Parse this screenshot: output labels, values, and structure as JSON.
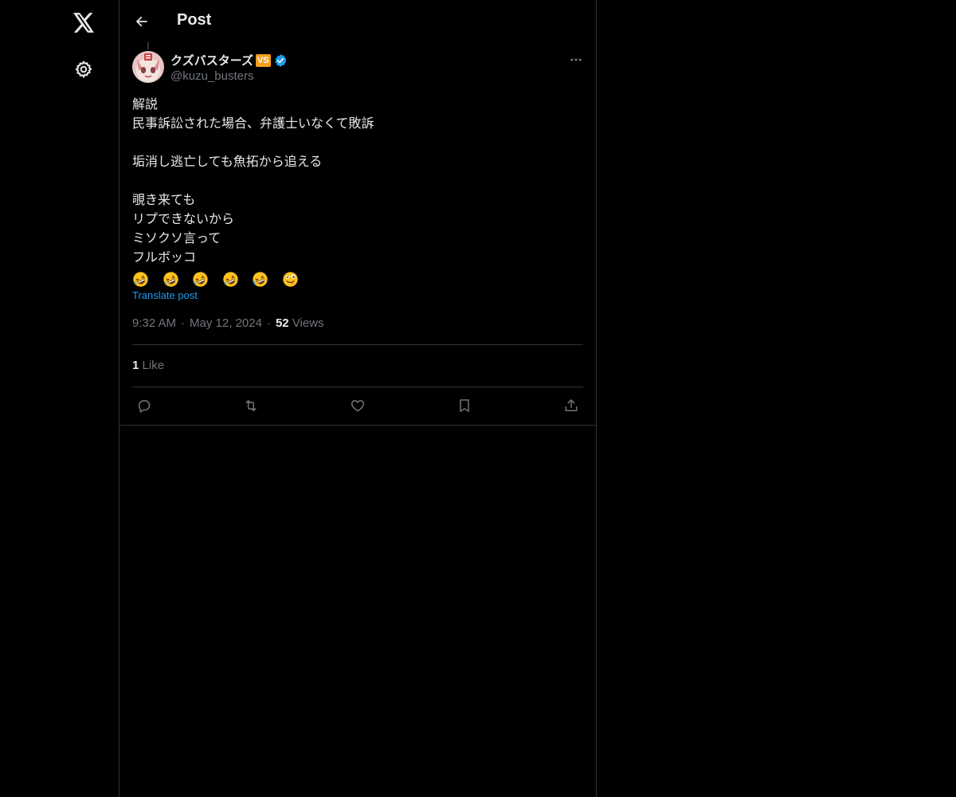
{
  "header": {
    "title": "Post"
  },
  "post": {
    "author": {
      "display_name": "クズバスターズ",
      "badge_text": "VS",
      "handle": "@kuzu_busters",
      "verified": true
    },
    "lines": [
      "解説",
      "民事訴訟された場合、弁護士いなくて敗訴",
      "",
      "垢消し逃亡しても魚拓から追える",
      "",
      "覗き来ても",
      "リプできないから",
      "ミソクソ言って",
      "フルボッコ"
    ],
    "emojis": [
      "rofl-emoji",
      "rofl-emoji",
      "rofl-emoji",
      "rofl-emoji",
      "rofl-emoji",
      "zany-face-emoji"
    ],
    "translate_label": "Translate post",
    "time": "9:32 AM",
    "separator": "·",
    "date": "May 12, 2024",
    "views_count": "52",
    "views_label": "Views",
    "likes_count": "1",
    "likes_label": "Like"
  },
  "colors": {
    "background": "#000000",
    "text": "#e7e9ea",
    "muted": "#71767b",
    "accent": "#1d9bf0",
    "border": "#2f3336",
    "badge": "#f59f1c"
  },
  "icons": {
    "logo": "x-logo-icon",
    "settings": "gear-icon",
    "back": "arrow-left-icon",
    "more": "more-horizontal-icon",
    "verified": "verified-check-icon",
    "reply": "reply-icon",
    "repost": "repost-icon",
    "like": "heart-icon",
    "bookmark": "bookmark-icon",
    "share": "share-icon"
  }
}
